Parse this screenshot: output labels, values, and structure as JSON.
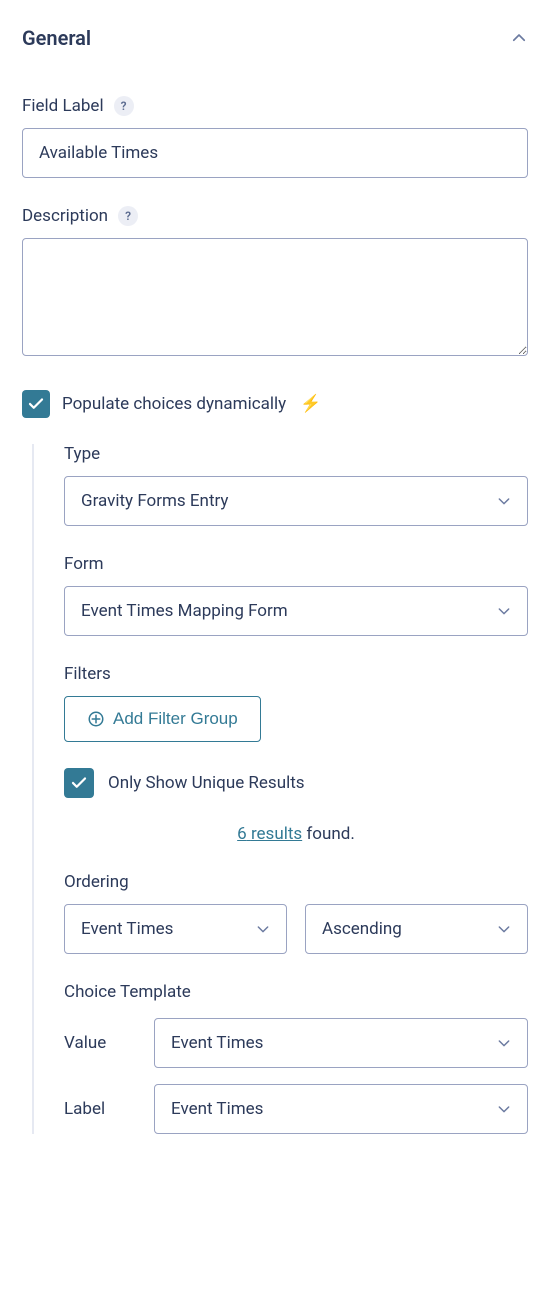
{
  "section": {
    "title": "General"
  },
  "field_label": {
    "label": "Field Label",
    "value": "Available Times"
  },
  "description": {
    "label": "Description",
    "value": ""
  },
  "populate_dynamic": {
    "label": "Populate choices dynamically",
    "checked": true
  },
  "type": {
    "label": "Type",
    "value": "Gravity Forms Entry"
  },
  "form": {
    "label": "Form",
    "value": "Event Times Mapping Form"
  },
  "filters": {
    "label": "Filters",
    "add_button": "Add Filter Group",
    "unique_label": "Only Show Unique Results",
    "unique_checked": true,
    "results_count": "6",
    "results_word": "results",
    "results_suffix": " found."
  },
  "ordering": {
    "label": "Ordering",
    "field": "Event Times",
    "direction": "Ascending"
  },
  "choice_template": {
    "label": "Choice Template",
    "value_label": "Value",
    "value_option": "Event Times",
    "label_label": "Label",
    "label_option": "Event Times"
  }
}
